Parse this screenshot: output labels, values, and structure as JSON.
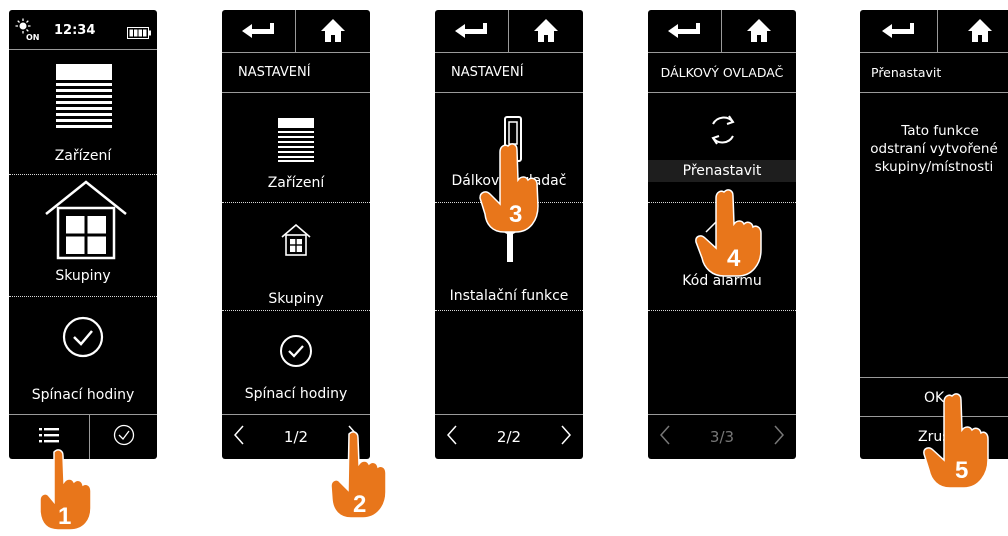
{
  "colors": {
    "screen": "#000000",
    "accent": "#e8761b",
    "text": "#ffffff",
    "divider": "#9a9a9a"
  },
  "screen1": {
    "status_icon": "sun-on-icon",
    "status_icon_sub": "ON",
    "time": "12:34",
    "battery_icon": "battery-icon",
    "items": [
      {
        "icon": "blind-icon",
        "label": "Zařízení"
      },
      {
        "icon": "house-icon",
        "label": "Skupiny"
      },
      {
        "icon": "check-circle-icon",
        "label": "Spínací hodiny"
      }
    ],
    "footer": {
      "left_icon": "list-icon",
      "right_icon": "clock-icon"
    }
  },
  "screen2": {
    "back_icon": "back-arrow-icon",
    "home_icon": "home-icon",
    "title": "NASTAVENÍ",
    "items": [
      {
        "icon": "blind-icon",
        "label": "Zařízení"
      },
      {
        "icon": "house-icon",
        "label": "Skupiny"
      },
      {
        "icon": "check-circle-icon",
        "label": "Spínací hodiny"
      }
    ],
    "pager": "1/2"
  },
  "screen3": {
    "back_icon": "back-arrow-icon",
    "home_icon": "home-icon",
    "title": "NASTAVENÍ",
    "items": [
      {
        "icon": "remote-icon",
        "label": "Dálkový ovladač"
      },
      {
        "icon": "wrench-icon",
        "label": "Instalační funkce"
      }
    ],
    "pager": "2/2"
  },
  "screen4": {
    "back_icon": "back-arrow-icon",
    "home_icon": "home-icon",
    "title": "DÁLKOVÝ OVLADAČ",
    "items": [
      {
        "icon": "refresh-icon",
        "label": "Přenastavit"
      },
      {
        "icon": "alarm-icon",
        "label": "Kód alarmu"
      }
    ],
    "pager": "3/3"
  },
  "screen5": {
    "back_icon": "back-arrow-icon",
    "home_icon": "home-icon",
    "title": "Přenastavit",
    "message_line1": "Tato funkce",
    "message_line2": "odstraní vytvořené",
    "message_line3": "skupiny/místnosti",
    "ok": "OK",
    "cancel": "Zrušit"
  },
  "steps": [
    "1",
    "2",
    "3",
    "4",
    "5"
  ]
}
